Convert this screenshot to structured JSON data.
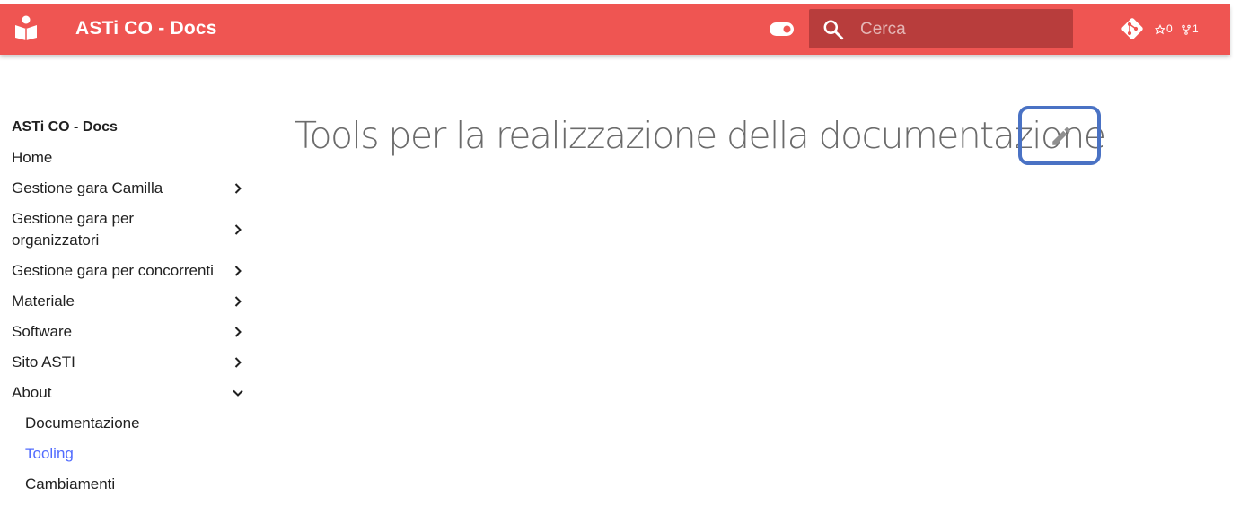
{
  "header": {
    "site_title": "ASTi CO - Docs",
    "accent_color": "#ef5552",
    "logo_icon": "book-reader-icon",
    "toggle_icon": "toggle-switch-icon",
    "search": {
      "placeholder": "Cerca",
      "value": "",
      "icon": "search-icon"
    },
    "repo": {
      "icon": "git-icon",
      "stars": "0",
      "forks": "1"
    }
  },
  "sidebar": {
    "title": "ASTi CO - Docs",
    "items": [
      {
        "label": "Home"
      },
      {
        "label": "Gestione gara Camilla",
        "icon": "chevron-right-icon"
      },
      {
        "label": "Gestione gara per organizzatori",
        "icon": "chevron-right-icon"
      },
      {
        "label": "Gestione gara per concorrenti",
        "icon": "chevron-right-icon"
      },
      {
        "label": "Materiale",
        "icon": "chevron-right-icon"
      },
      {
        "label": "Software",
        "icon": "chevron-right-icon"
      },
      {
        "label": "Sito ASTI",
        "icon": "chevron-right-icon"
      },
      {
        "label": "About",
        "icon": "chevron-down-icon",
        "expanded": true,
        "children": [
          {
            "label": "Documentazione"
          },
          {
            "label": "Tooling",
            "active": true
          },
          {
            "label": "Cambiamenti"
          }
        ]
      }
    ],
    "active_color": "#526cfe"
  },
  "main": {
    "title": "Tools per la realizzazione della documentazione",
    "edit_icon": "pencil-icon",
    "highlight_color": "#4a72c4"
  }
}
